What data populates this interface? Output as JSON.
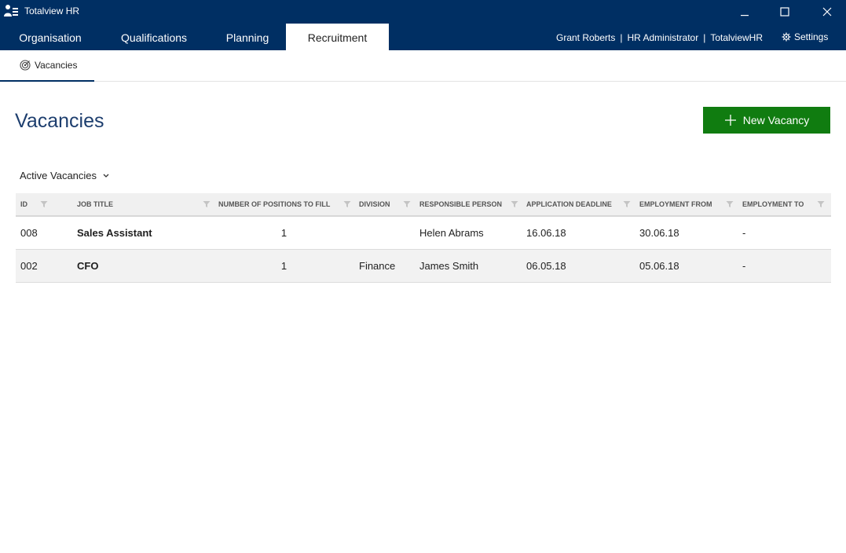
{
  "app": {
    "title": "Totalview HR"
  },
  "nav": {
    "tabs": [
      {
        "label": "Organisation"
      },
      {
        "label": "Qualifications"
      },
      {
        "label": "Planning"
      },
      {
        "label": "Recruitment"
      }
    ],
    "active_tab": "Recruitment",
    "user": {
      "name": "Grant Roberts",
      "role": "HR Administrator",
      "company": "TotalviewHR"
    },
    "settings_label": "Settings"
  },
  "subnav": {
    "tabs": [
      {
        "label": "Vacancies",
        "icon": "target-icon"
      }
    ]
  },
  "page": {
    "title": "Vacancies",
    "new_button_label": "New Vacancy",
    "filter_label": "Active Vacancies"
  },
  "table": {
    "columns": [
      "ID",
      "Job Title",
      "Number of Positions to Fill",
      "Division",
      "Responsible Person",
      "Application Deadline",
      "Employment From",
      "Employment To"
    ],
    "rows": [
      {
        "id": "008",
        "job_title": "Sales Assistant",
        "positions": "1",
        "division": "",
        "responsible": "Helen Abrams",
        "deadline": "16.06.18",
        "from": "30.06.18",
        "to": "-"
      },
      {
        "id": "002",
        "job_title": "CFO",
        "positions": "1",
        "division": "Finance",
        "responsible": "James Smith",
        "deadline": "06.05.18",
        "from": "05.06.18",
        "to": "-"
      }
    ]
  },
  "colors": {
    "header_bg": "#002f63",
    "accent_green": "#107c10",
    "title_blue": "#1d3e6e"
  }
}
